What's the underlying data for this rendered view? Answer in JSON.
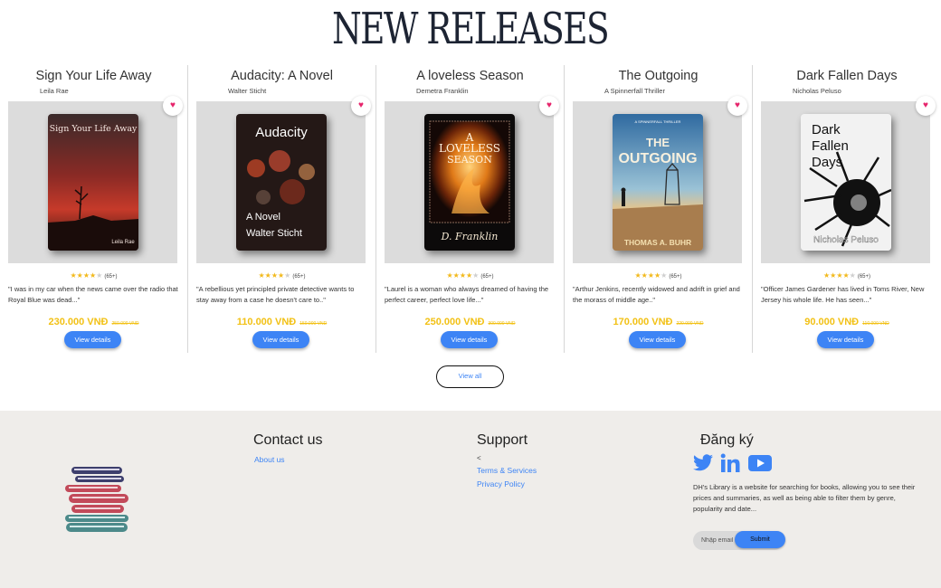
{
  "section": {
    "title": "NEW RELEASES",
    "view_all": "View all"
  },
  "books": [
    {
      "title": "Sign Your Life Away",
      "author": "Leila Rae",
      "cover_title": "Sign Your Life Away",
      "cover_author": "Leila Rae",
      "rating": 4,
      "review_count": "(65+)",
      "description": "\"I was in my car when the news came over the radio that Royal Blue was dead...\"",
      "price": "230.000 VNĐ",
      "old_price": "250.000 VNĐ",
      "button": "View details"
    },
    {
      "title": "Audacity: A Novel",
      "author": "Walter Sticht",
      "cover_title": "Audacity",
      "cover_subtitle": "A Novel",
      "cover_author": "Walter Sticht",
      "rating": 4,
      "review_count": "(65+)",
      "description": "\"A rebellious yet principled private detective wants to stay away from a case he doesn't care to..\"",
      "price": "110.000 VNĐ",
      "old_price": "150.000 VNĐ",
      "button": "View details"
    },
    {
      "title": "A loveless Season",
      "author": "Demetra Franklin",
      "cover_title_1": "A",
      "cover_title_2": "LOVELESS",
      "cover_title_3": "SEASON",
      "cover_author": "D. Franklin",
      "rating": 4,
      "review_count": "(65+)",
      "description": "\"Laurel is a woman who always dreamed of having the perfect career, perfect love life...\"",
      "price": "250.000 VNĐ",
      "old_price": "300.000 VNĐ",
      "button": "View details"
    },
    {
      "title": "The Outgoing",
      "author": "A Spinnerfall Thriller",
      "cover_series": "A SPINNERFALL THRILLER",
      "cover_title_1": "THE",
      "cover_title_2": "OUTGOING",
      "cover_author": "THOMAS A. BUHR",
      "rating": 4,
      "review_count": "(65+)",
      "description": "\"Arthur Jenkins, recently widowed and adrift in grief and the morass of middle age..\"",
      "price": "170.000 VNĐ",
      "old_price": "220.000 VNĐ",
      "button": "View details"
    },
    {
      "title": "Dark Fallen Days",
      "author": "Nicholas Peluso",
      "cover_title_1": "Dark",
      "cover_title_2": "Fallen",
      "cover_title_3": "Days",
      "cover_author": "Nicholas Peluso",
      "rating": 4,
      "review_count": "(65+)",
      "description": "\"Officer James Gardener has lived in Toms River, New Jersey his whole life. He has seen...\"",
      "price": "90.000 VNĐ",
      "old_price": "110.000 VNĐ",
      "button": "View details"
    }
  ],
  "footer": {
    "contact_heading": "Contact us",
    "contact_links": [
      "About us"
    ],
    "support_heading": "Support",
    "support_marker": "<",
    "support_links": [
      "Terms & Services",
      "Privacy Policy"
    ],
    "register_heading": "Đăng ký",
    "socials": [
      "twitter-icon",
      "linkedin-icon",
      "youtube-icon"
    ],
    "about_text": "DH's Library is a website for searching for books, allowing you to see their prices and summaries, as well as being able to filter them by genre, popularity and date...",
    "email_placeholder": "Nhập email",
    "submit": "Submit"
  },
  "colors": {
    "accent": "#3d84f5",
    "price": "#f2c115",
    "heart": "#e6246b",
    "footer_bg": "#efedea"
  }
}
